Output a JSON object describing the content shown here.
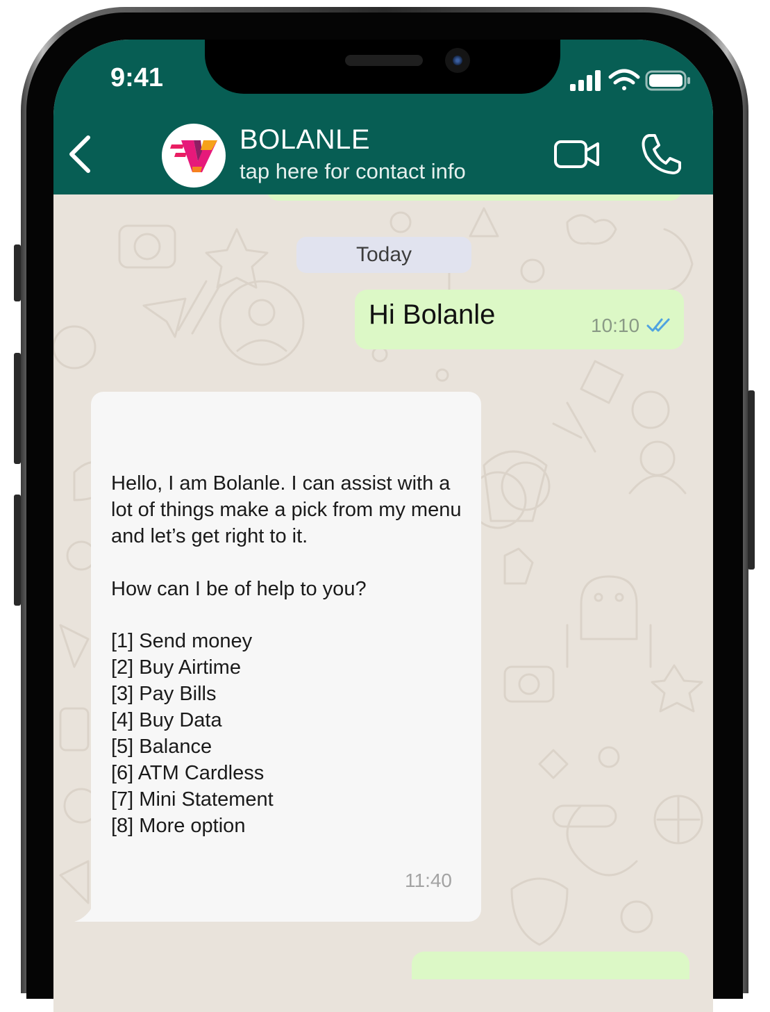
{
  "status_bar": {
    "time": "9:41",
    "icons": [
      "cellular-signal-icon",
      "wifi-icon",
      "battery-icon"
    ]
  },
  "header": {
    "back_icon": "chevron-left-icon",
    "contact_name": "BOLANLE",
    "contact_subtitle": "tap here for contact info",
    "video_call_icon": "video-camera-icon",
    "voice_call_icon": "phone-icon"
  },
  "chat": {
    "date_separator": "Today",
    "messages": [
      {
        "direction": "outgoing",
        "text": "Hi Bolanle",
        "time": "10:10",
        "status": "read"
      },
      {
        "direction": "incoming",
        "paragraphs": [
          "Hello, I am Bolanle. I can assist with a lot of things make a pick from my menu and let’s get right to it.",
          "How can I be of help to you?"
        ],
        "menu": [
          "[1] Send money",
          "[2] Buy Airtime",
          "[3] Pay Bills",
          "[4] Buy Data",
          "[5] Balance",
          "[6] ATM Cardless",
          "[7] Mini Statement",
          "[8] More option"
        ],
        "time": "11:40"
      }
    ]
  },
  "colors": {
    "header": "#075e54",
    "outgoing_bubble": "#dcf8c6",
    "incoming_bubble": "#f7f7f7",
    "wallpaper": "#e9e3db",
    "read_ticks": "#4fa3e0",
    "date_chip": "#e1e3ef"
  }
}
